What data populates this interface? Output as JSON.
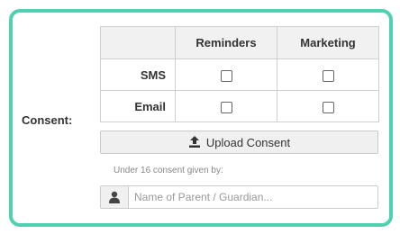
{
  "consent": {
    "label": "Consent:",
    "columns": [
      "Reminders",
      "Marketing"
    ],
    "rows": [
      {
        "channel": "SMS",
        "reminders": false,
        "marketing": false
      },
      {
        "channel": "Email",
        "reminders": false,
        "marketing": false
      }
    ]
  },
  "upload": {
    "label": "Upload Consent",
    "icon": "upload-icon"
  },
  "under16": {
    "hint": "Under 16 consent given by:",
    "placeholder": "Name of Parent / Guardian...",
    "value": "",
    "icon": "user-icon"
  },
  "colors": {
    "accent_border": "#4fd0b0",
    "header_bg": "#f1f1f1"
  }
}
